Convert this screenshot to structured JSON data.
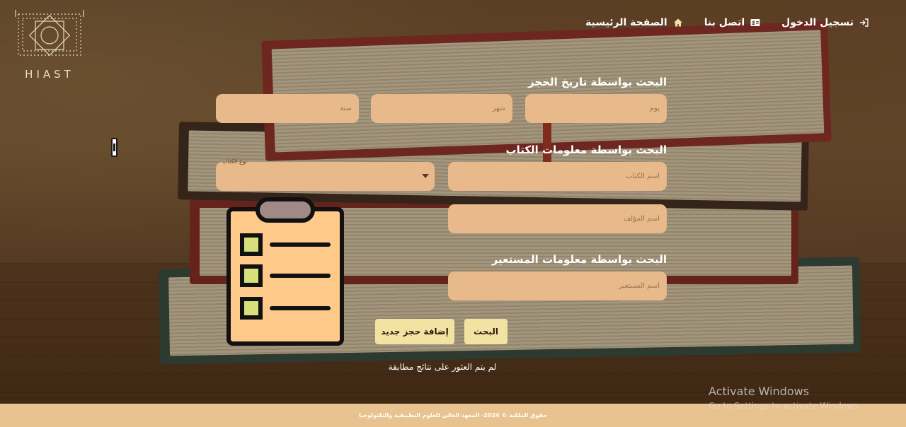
{
  "brand": {
    "logo_text": "HIAST"
  },
  "nav": {
    "login": "تسجيل الدخول",
    "contact": "اتصل بنا",
    "home": "الصفحة الرئيسية"
  },
  "sections": {
    "date_title": "البحث بواسطة تاريخ الحجز",
    "book_title": "البحث بواسطة معلومات الكتاب",
    "borrower_title": "البحث بواسطة معلومات المستعير"
  },
  "fields": {
    "day_placeholder": "يوم",
    "month_placeholder": "شهر",
    "year_placeholder": "سنة",
    "book_name_placeholder": "اسم الكتاب",
    "author_placeholder": "اسم المؤلف",
    "book_type_label": "نوع الكتاب",
    "borrower_placeholder": "اسم المستعير"
  },
  "buttons": {
    "search": "البحث",
    "add_reservation": "إضافة حجز جديد"
  },
  "status": {
    "no_results": "لم يتم العثور على نتائج مطابقة"
  },
  "footer": {
    "text": "حقوق الملكية © 2024- المعهد العالي للعلوم التطبيقية والتكنولوجيا"
  },
  "system": {
    "activate_title": "Activate Windows",
    "activate_subtitle": "Go to Settings to activate Windows."
  },
  "colors": {
    "field_bg": "#e8b98a",
    "button_bg": "#f3e3a3",
    "footer_bg": "#e8c38f",
    "clipboard_fill": "#ffc98a",
    "clipboard_check": "#d6df7a"
  },
  "icons": {
    "login": "login-icon",
    "contact": "contact-card-icon",
    "home": "home-icon",
    "clipboard": "clipboard-checklist-icon"
  }
}
